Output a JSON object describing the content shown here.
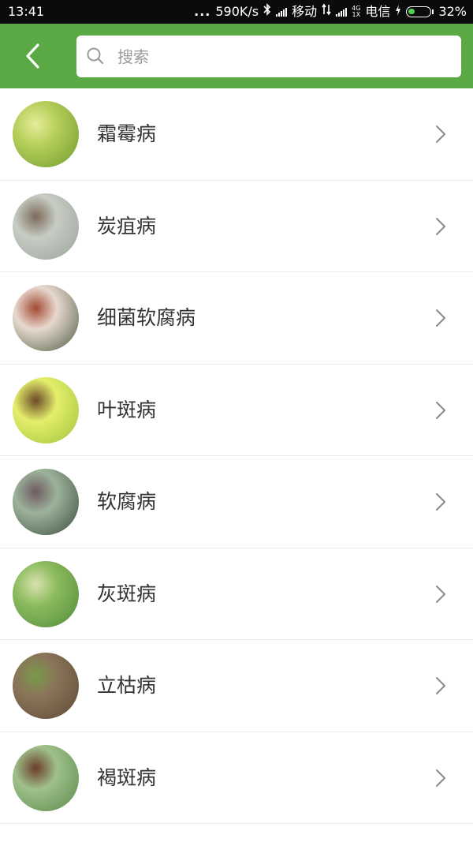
{
  "status_bar": {
    "time": "13:41",
    "dots": "...",
    "speed": "590K/s",
    "carrier1": "移动",
    "net_top": "4G",
    "net_bottom": "1X",
    "carrier2": "电信",
    "battery": "32%",
    "battery_level": 0.32
  },
  "header": {
    "back_icon": "chevron-left-icon",
    "search_placeholder": "搜索",
    "search_value": ""
  },
  "colors": {
    "brand_green": "#5aa944",
    "status_bg": "#0b0b0b",
    "text_primary": "#333333",
    "divider": "#ebebeb"
  },
  "diseases": [
    {
      "name": "霜霉病",
      "thumb_colors": [
        "#6f9a2f",
        "#b6cf5a",
        "#e7ec9a"
      ]
    },
    {
      "name": "炭疽病",
      "thumb_colors": [
        "#9aa39b",
        "#c7ccc4",
        "#7d6b5a"
      ]
    },
    {
      "name": "细菌软腐病",
      "thumb_colors": [
        "#4b5b3f",
        "#e8d9cf",
        "#a24a32"
      ]
    },
    {
      "name": "叶斑病",
      "thumb_colors": [
        "#9ec23a",
        "#e4ee6b",
        "#6b4a28"
      ]
    },
    {
      "name": "软腐病",
      "thumb_colors": [
        "#3c4a3f",
        "#9cb39a",
        "#6e5a62"
      ]
    },
    {
      "name": "灰斑病",
      "thumb_colors": [
        "#4f8a3a",
        "#8dbb5e",
        "#d9e2b0"
      ]
    },
    {
      "name": "立枯病",
      "thumb_colors": [
        "#5d4a36",
        "#8a7459",
        "#7a9a4a"
      ]
    },
    {
      "name": "褐斑病",
      "thumb_colors": [
        "#5a8a4a",
        "#9fc08a",
        "#6c3e2c"
      ]
    }
  ]
}
